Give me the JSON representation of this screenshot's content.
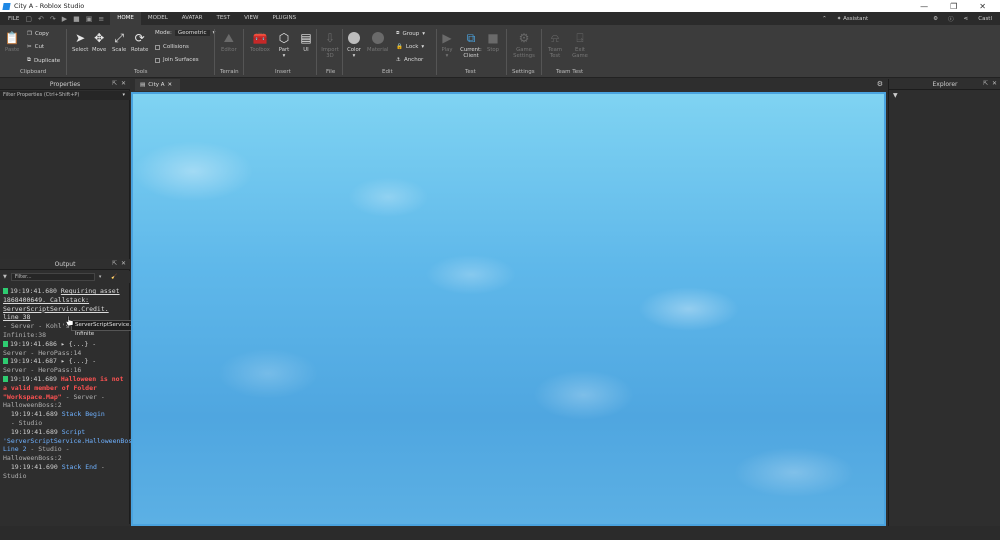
{
  "window": {
    "title": "City A - Roblox Studio",
    "controls": [
      "—",
      "❐",
      "✕"
    ]
  },
  "menu": {
    "file": "FILE",
    "tabs": [
      "HOME",
      "MODEL",
      "AVATAR",
      "TEST",
      "VIEW",
      "PLUGINS"
    ],
    "active_tab": "HOME",
    "assistant": "Assistant",
    "user": "Castl"
  },
  "ribbon": {
    "clipboard": {
      "paste": "Paste",
      "copy": "Copy",
      "cut": "Cut",
      "duplicate": "Duplicate",
      "label": "Clipboard"
    },
    "tools": {
      "select": "Select",
      "move": "Move",
      "scale": "Scale",
      "rotate": "Rotate",
      "mode_label": "Mode:",
      "mode_value": "Geometric",
      "collisions": "Collisions",
      "join_surfaces": "Join Surfaces",
      "label": "Tools"
    },
    "terrain": {
      "editor": "Editor",
      "label": "Terrain"
    },
    "insert": {
      "toolbox": "Toolbox",
      "part": "Part",
      "ui": "UI",
      "label": "Insert"
    },
    "file": {
      "import3d": "Import 3D",
      "label": "File"
    },
    "edit": {
      "color": "Color",
      "material": "Material",
      "group": "Group",
      "lock": "Lock",
      "anchor": "Anchor",
      "label": "Edit"
    },
    "test": {
      "play": "Play",
      "current_client": "Current: Client",
      "stop": "Stop",
      "label": "Test"
    },
    "settings": {
      "game_settings": "Game Settings",
      "label": "Settings"
    },
    "team_test": {
      "team_test": "Team Test",
      "exit_game": "Exit Game",
      "label": "Team Test"
    }
  },
  "properties": {
    "title": "Properties",
    "filter": "Filter Properties (Ctrl+Shift+P)"
  },
  "output": {
    "title": "Output",
    "filter_placeholder": "Filter...",
    "log": {
      "l1_time": "19:19:41.680",
      "l1_msg": "Requiring asset 1868400649. Callstack: ServerScriptService.Credit. line 38",
      "l1_src": "- Server - Kohl's Admin Infinite:38",
      "l2_time": "19:19:41.686",
      "l2_msg": "▸ {...} -",
      "l2_src": "Server - HeroPass:14",
      "l3_time": "19:19:41.687",
      "l3_msg": "▸ {...} -",
      "l3_src": "Server - HeroPass:16",
      "l4_time": "19:19:41.689",
      "l4_msg": "Halloween is not a valid member of Folder \"Workspace.Map\"",
      "l4_src": "- Server - HalloweenBoss:2",
      "l5_time": "19:19:41.689",
      "l5_msg": "Stack Begin",
      "l5_src": "- Studio",
      "l6_time": "19:19:41.689",
      "l6_msg": "Script 'ServerScriptService.HalloweenBoss', Line 2",
      "l6_src": "- Studio - HalloweenBoss:2",
      "l7_time": "19:19:41.690",
      "l7_msg": "Stack End",
      "l7_src": "- Studio"
    }
  },
  "tooltip": "ServerScriptService.Kohl's Admin Infinite",
  "viewport": {
    "tab": "City A"
  },
  "explorer": {
    "title": "Explorer"
  }
}
